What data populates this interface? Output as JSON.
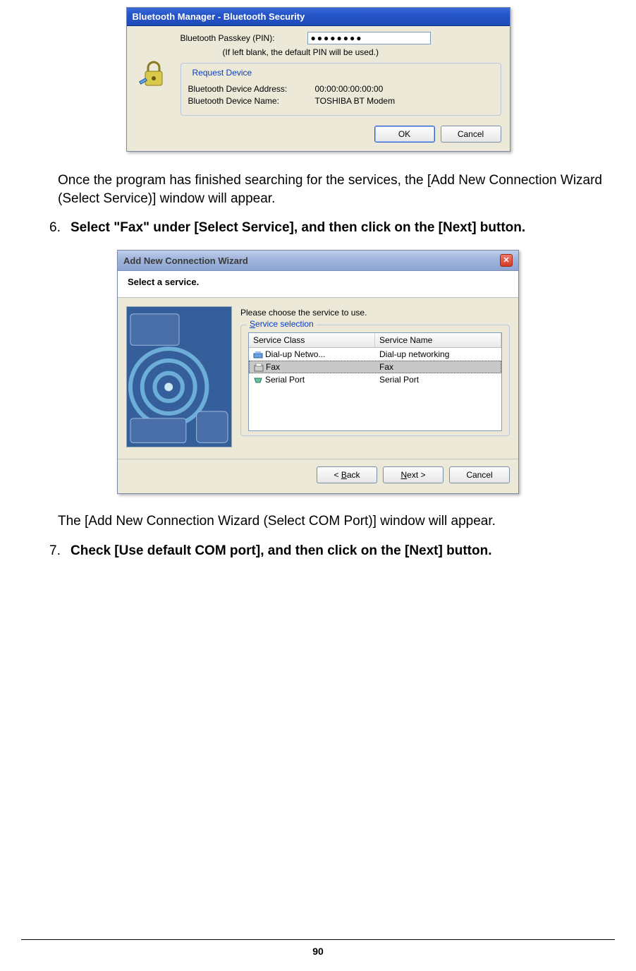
{
  "dialog1": {
    "title": "Bluetooth Manager - Bluetooth Security",
    "pin_label": "Bluetooth Passkey (PIN):",
    "pin_value": "●●●●●●●●",
    "pin_note": "(If left blank, the default PIN will be used.)",
    "group_legend": "Request Device",
    "addr_label": "Bluetooth Device Address:",
    "addr_value": "00:00:00:00:00:00",
    "name_label": "Bluetooth Device Name:",
    "name_value": "TOSHIBA BT Modem",
    "ok": "OK",
    "cancel": "Cancel"
  },
  "text": {
    "para1": "Once the program has finished searching for the services, the [Add New Connection Wizard (Select Service)] window will appear.",
    "step6_num": "6.",
    "step6_text": "Select \"Fax\" under [Select Service], and then click on the [Next] button.",
    "para2": "The [Add New Connection Wizard (Select COM Port)] window will appear.",
    "step7_num": "7.",
    "step7_text": "Check [Use default COM port], and then click on the [Next] button."
  },
  "dialog2": {
    "title": "Add New Connection Wizard",
    "subtitle": "Select a service.",
    "instruction": "Please choose the service to use.",
    "legend_prefix": "S",
    "legend_rest": "ervice selection",
    "col1": "Service Class",
    "col2": "Service Name",
    "rows": [
      {
        "class": "Dial-up Netwo...",
        "name": "Dial-up networking",
        "selected": false,
        "icon": "modem"
      },
      {
        "class": "Fax",
        "name": "Fax",
        "selected": true,
        "icon": "fax"
      },
      {
        "class": "Serial Port",
        "name": "Serial Port",
        "selected": false,
        "icon": "serial"
      }
    ],
    "back_u": "B",
    "back_rest": "ack",
    "next_u": "N",
    "next_rest": "ext >",
    "cancel": "Cancel"
  },
  "footer": {
    "page_num": "90"
  }
}
